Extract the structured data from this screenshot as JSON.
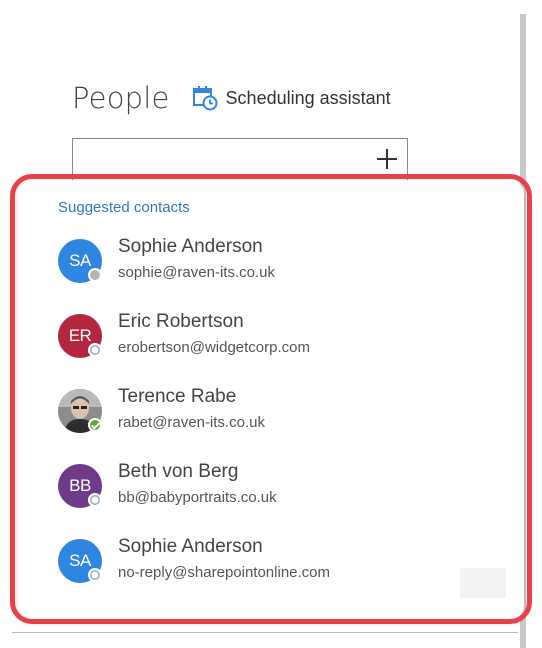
{
  "people": {
    "title": "People",
    "scheduling_label": "Scheduling assistant"
  },
  "suggestions": {
    "heading": "Suggested contacts",
    "contacts": [
      {
        "initials": "SA",
        "name": "Sophie Anderson",
        "email": "sophie@raven-its.co.uk",
        "avatar_color": "#2f86e0",
        "presence": "offline"
      },
      {
        "initials": "ER",
        "name": "Eric Robertson",
        "email": "erobertson@widgetcorp.com",
        "avatar_color": "#b3263f",
        "presence": "unknown"
      },
      {
        "initials": "",
        "name": "Terence Rabe",
        "email": "rabet@raven-its.co.uk",
        "avatar_color": "#9a9a9a",
        "presence": "available"
      },
      {
        "initials": "BB",
        "name": "Beth von Berg",
        "email": "bb@babyportraits.co.uk",
        "avatar_color": "#6d3b8a",
        "presence": "unknown"
      },
      {
        "initials": "SA",
        "name": "Sophie Anderson",
        "email": "no-reply@sharepointonline.com",
        "avatar_color": "#2f86e0",
        "presence": "unknown"
      }
    ]
  },
  "colors": {
    "highlight": "#e8414a",
    "link": "#2f79c4",
    "scheduling_icon": "#2f86e0"
  },
  "icons": {
    "scheduling": "calendar-clock-icon",
    "add": "plus-icon"
  }
}
